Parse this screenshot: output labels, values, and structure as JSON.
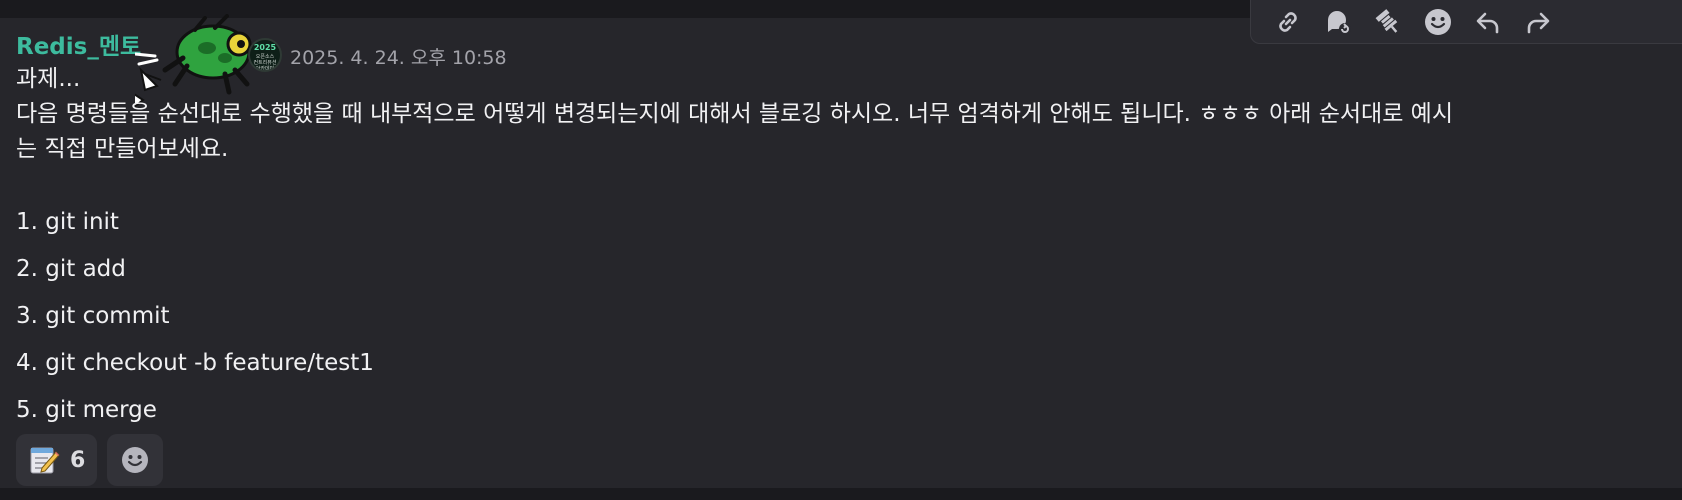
{
  "message": {
    "author": "Redis_멘토",
    "timestamp": "2025. 4. 24. 오후 10:58",
    "server_badge": {
      "year": "2025",
      "lines": [
        "오픈소스",
        "컨트리뷰션",
        "아카데미"
      ]
    },
    "lines": [
      "과제...",
      "다음 명령들을 순선대로 수행했을 때 내부적으로 어떻게 변경되는지에 대해서 블로깅 하시오. 너무 엄격하게 안해도 됩니다. ㅎㅎㅎ 아래 순서대로 예시",
      "는 직접 만들어보세요."
    ],
    "steps": [
      "1. git init",
      "2. git add",
      "3. git commit",
      "4. git checkout -b feature/test1",
      "5. git merge"
    ]
  },
  "reactions": [
    {
      "emoji": "memo-icon",
      "count": "6"
    }
  ],
  "toolbar": {
    "icons": [
      "link-icon",
      "thread-icon",
      "pin-icon",
      "emoji-icon",
      "reply-icon",
      "forward-icon"
    ]
  },
  "colors": {
    "username": "#3dbb9e",
    "background": "#26262b",
    "text": "#f1f1f3",
    "timestamp": "#a3a3aa"
  }
}
